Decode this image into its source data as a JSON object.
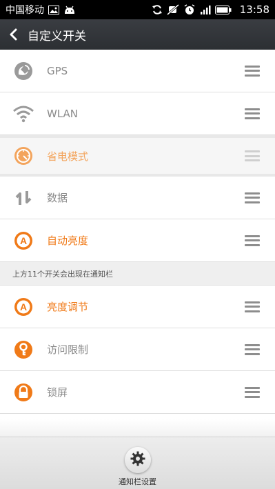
{
  "status_bar": {
    "carrier": "中国移动",
    "time": "13:58",
    "icons": [
      "image-icon",
      "android-icon",
      "sync-icon",
      "mute-icon",
      "alarm-icon",
      "signal-icon",
      "battery-icon"
    ]
  },
  "header": {
    "title": "自定义开关",
    "back_icon": "chevron-left-icon"
  },
  "toggles_top": [
    {
      "label": "GPS",
      "icon": "gps-icon",
      "active": false
    },
    {
      "label": "WLAN",
      "icon": "wifi-icon",
      "active": false
    },
    {
      "label": "省电模式",
      "icon": "power-save-icon",
      "active": true,
      "dragging": true
    },
    {
      "label": "数据",
      "icon": "data-icon",
      "active": false
    },
    {
      "label": "自动亮度",
      "icon": "auto-brightness-icon",
      "active": true
    }
  ],
  "section_note": "上方11个开关会出现在通知栏",
  "toggles_bottom": [
    {
      "label": "亮度调节",
      "icon": "brightness-icon",
      "active": true
    },
    {
      "label": "访问限制",
      "icon": "key-icon",
      "active": false
    },
    {
      "label": "锁屏",
      "icon": "lock-icon",
      "active": false
    }
  ],
  "bottom_bar": {
    "label": "通知栏设置",
    "icon": "gear-icon"
  },
  "colors": {
    "accent": "#f07a18",
    "inactive": "#8a8a8a",
    "titlebar": "#33363a"
  }
}
